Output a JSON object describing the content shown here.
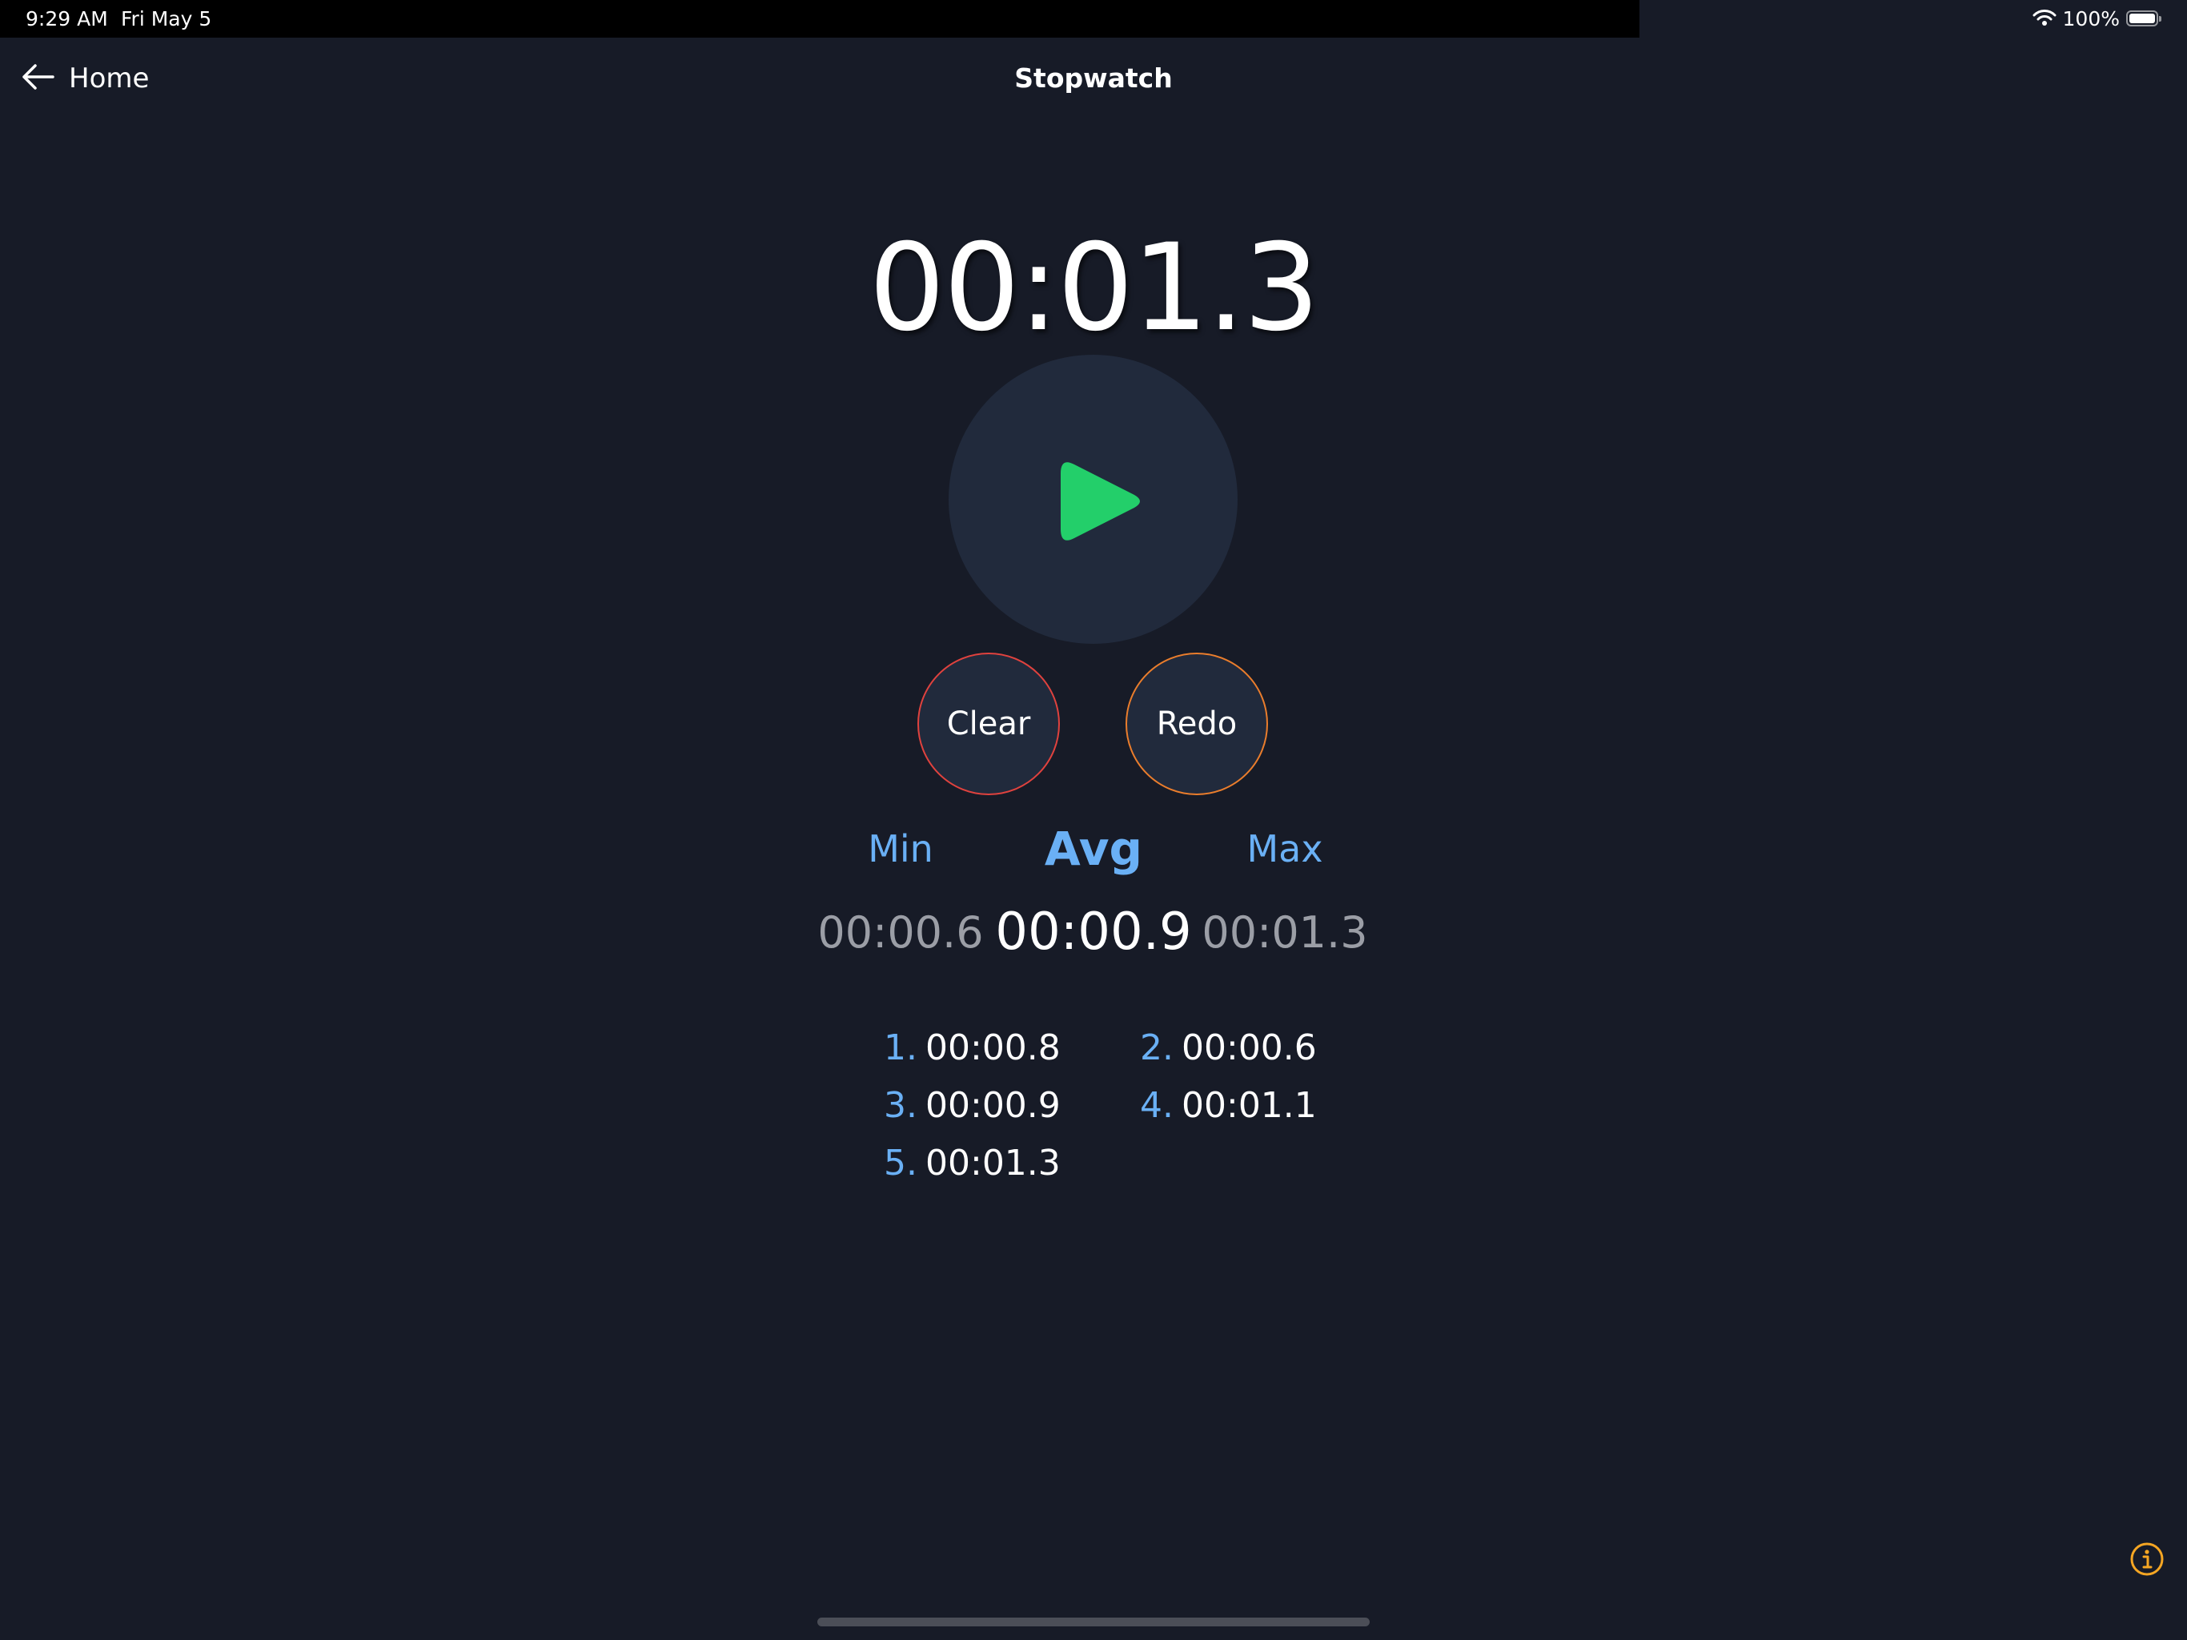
{
  "status_bar": {
    "time": "9:29 AM",
    "date": "Fri May 5",
    "battery_percent": "100%",
    "battery_level": 1.0,
    "wifi_icon": "wifi-icon",
    "battery_icon": "battery-icon"
  },
  "nav": {
    "back_label": "Home",
    "back_icon": "arrow-left-icon",
    "title": "Stopwatch"
  },
  "timer": {
    "display": "00:01.3"
  },
  "controls": {
    "play_icon": "play-icon",
    "clear_label": "Clear",
    "redo_label": "Redo"
  },
  "stats": {
    "min_label": "Min",
    "avg_label": "Avg",
    "max_label": "Max",
    "min_value": "00:00.6",
    "avg_value": "00:00.9",
    "max_value": "00:01.3"
  },
  "laps": [
    {
      "number": "1",
      "time": "00:00.8"
    },
    {
      "number": "2",
      "time": "00:00.6"
    },
    {
      "number": "3",
      "time": "00:00.9"
    },
    {
      "number": "4",
      "time": "00:01.1"
    },
    {
      "number": "5",
      "time": "00:01.3"
    }
  ],
  "info_icon": "info-icon",
  "colors": {
    "background": "#171b27",
    "button_fill": "#212a3c",
    "play_green": "#23cf6a",
    "accent_blue": "#6ab0f5",
    "clear_red": "#e0423e",
    "redo_orange": "#ea7d2c",
    "info_orange": "#f5a623",
    "secondary_text": "#9b9ea6"
  }
}
